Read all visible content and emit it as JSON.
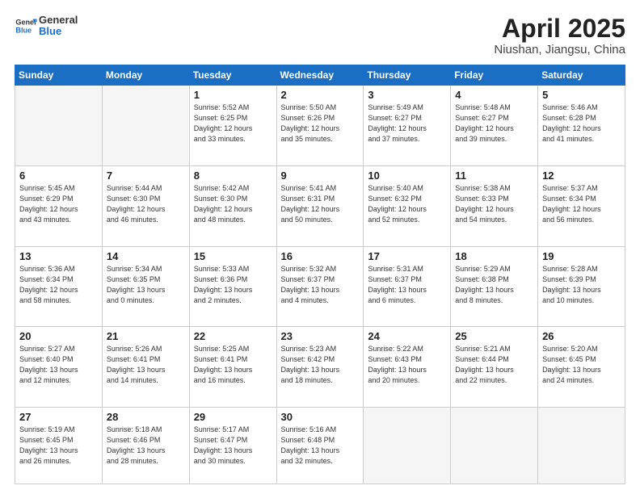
{
  "header": {
    "logo_general": "General",
    "logo_blue": "Blue",
    "title": "April 2025",
    "subtitle": "Niushan, Jiangsu, China"
  },
  "weekdays": [
    "Sunday",
    "Monday",
    "Tuesday",
    "Wednesday",
    "Thursday",
    "Friday",
    "Saturday"
  ],
  "days": [
    {
      "num": "",
      "info": ""
    },
    {
      "num": "",
      "info": ""
    },
    {
      "num": "1",
      "info": "Sunrise: 5:52 AM\nSunset: 6:25 PM\nDaylight: 12 hours\nand 33 minutes."
    },
    {
      "num": "2",
      "info": "Sunrise: 5:50 AM\nSunset: 6:26 PM\nDaylight: 12 hours\nand 35 minutes."
    },
    {
      "num": "3",
      "info": "Sunrise: 5:49 AM\nSunset: 6:27 PM\nDaylight: 12 hours\nand 37 minutes."
    },
    {
      "num": "4",
      "info": "Sunrise: 5:48 AM\nSunset: 6:27 PM\nDaylight: 12 hours\nand 39 minutes."
    },
    {
      "num": "5",
      "info": "Sunrise: 5:46 AM\nSunset: 6:28 PM\nDaylight: 12 hours\nand 41 minutes."
    },
    {
      "num": "6",
      "info": "Sunrise: 5:45 AM\nSunset: 6:29 PM\nDaylight: 12 hours\nand 43 minutes."
    },
    {
      "num": "7",
      "info": "Sunrise: 5:44 AM\nSunset: 6:30 PM\nDaylight: 12 hours\nand 46 minutes."
    },
    {
      "num": "8",
      "info": "Sunrise: 5:42 AM\nSunset: 6:30 PM\nDaylight: 12 hours\nand 48 minutes."
    },
    {
      "num": "9",
      "info": "Sunrise: 5:41 AM\nSunset: 6:31 PM\nDaylight: 12 hours\nand 50 minutes."
    },
    {
      "num": "10",
      "info": "Sunrise: 5:40 AM\nSunset: 6:32 PM\nDaylight: 12 hours\nand 52 minutes."
    },
    {
      "num": "11",
      "info": "Sunrise: 5:38 AM\nSunset: 6:33 PM\nDaylight: 12 hours\nand 54 minutes."
    },
    {
      "num": "12",
      "info": "Sunrise: 5:37 AM\nSunset: 6:34 PM\nDaylight: 12 hours\nand 56 minutes."
    },
    {
      "num": "13",
      "info": "Sunrise: 5:36 AM\nSunset: 6:34 PM\nDaylight: 12 hours\nand 58 minutes."
    },
    {
      "num": "14",
      "info": "Sunrise: 5:34 AM\nSunset: 6:35 PM\nDaylight: 13 hours\nand 0 minutes."
    },
    {
      "num": "15",
      "info": "Sunrise: 5:33 AM\nSunset: 6:36 PM\nDaylight: 13 hours\nand 2 minutes."
    },
    {
      "num": "16",
      "info": "Sunrise: 5:32 AM\nSunset: 6:37 PM\nDaylight: 13 hours\nand 4 minutes."
    },
    {
      "num": "17",
      "info": "Sunrise: 5:31 AM\nSunset: 6:37 PM\nDaylight: 13 hours\nand 6 minutes."
    },
    {
      "num": "18",
      "info": "Sunrise: 5:29 AM\nSunset: 6:38 PM\nDaylight: 13 hours\nand 8 minutes."
    },
    {
      "num": "19",
      "info": "Sunrise: 5:28 AM\nSunset: 6:39 PM\nDaylight: 13 hours\nand 10 minutes."
    },
    {
      "num": "20",
      "info": "Sunrise: 5:27 AM\nSunset: 6:40 PM\nDaylight: 13 hours\nand 12 minutes."
    },
    {
      "num": "21",
      "info": "Sunrise: 5:26 AM\nSunset: 6:41 PM\nDaylight: 13 hours\nand 14 minutes."
    },
    {
      "num": "22",
      "info": "Sunrise: 5:25 AM\nSunset: 6:41 PM\nDaylight: 13 hours\nand 16 minutes."
    },
    {
      "num": "23",
      "info": "Sunrise: 5:23 AM\nSunset: 6:42 PM\nDaylight: 13 hours\nand 18 minutes."
    },
    {
      "num": "24",
      "info": "Sunrise: 5:22 AM\nSunset: 6:43 PM\nDaylight: 13 hours\nand 20 minutes."
    },
    {
      "num": "25",
      "info": "Sunrise: 5:21 AM\nSunset: 6:44 PM\nDaylight: 13 hours\nand 22 minutes."
    },
    {
      "num": "26",
      "info": "Sunrise: 5:20 AM\nSunset: 6:45 PM\nDaylight: 13 hours\nand 24 minutes."
    },
    {
      "num": "27",
      "info": "Sunrise: 5:19 AM\nSunset: 6:45 PM\nDaylight: 13 hours\nand 26 minutes."
    },
    {
      "num": "28",
      "info": "Sunrise: 5:18 AM\nSunset: 6:46 PM\nDaylight: 13 hours\nand 28 minutes."
    },
    {
      "num": "29",
      "info": "Sunrise: 5:17 AM\nSunset: 6:47 PM\nDaylight: 13 hours\nand 30 minutes."
    },
    {
      "num": "30",
      "info": "Sunrise: 5:16 AM\nSunset: 6:48 PM\nDaylight: 13 hours\nand 32 minutes."
    },
    {
      "num": "",
      "info": ""
    },
    {
      "num": "",
      "info": ""
    },
    {
      "num": "",
      "info": ""
    },
    {
      "num": "",
      "info": ""
    },
    {
      "num": "",
      "info": ""
    },
    {
      "num": "",
      "info": ""
    },
    {
      "num": "",
      "info": ""
    },
    {
      "num": "",
      "info": ""
    },
    {
      "num": "",
      "info": ""
    },
    {
      "num": "",
      "info": ""
    },
    {
      "num": "",
      "info": ""
    },
    {
      "num": "",
      "info": ""
    }
  ]
}
